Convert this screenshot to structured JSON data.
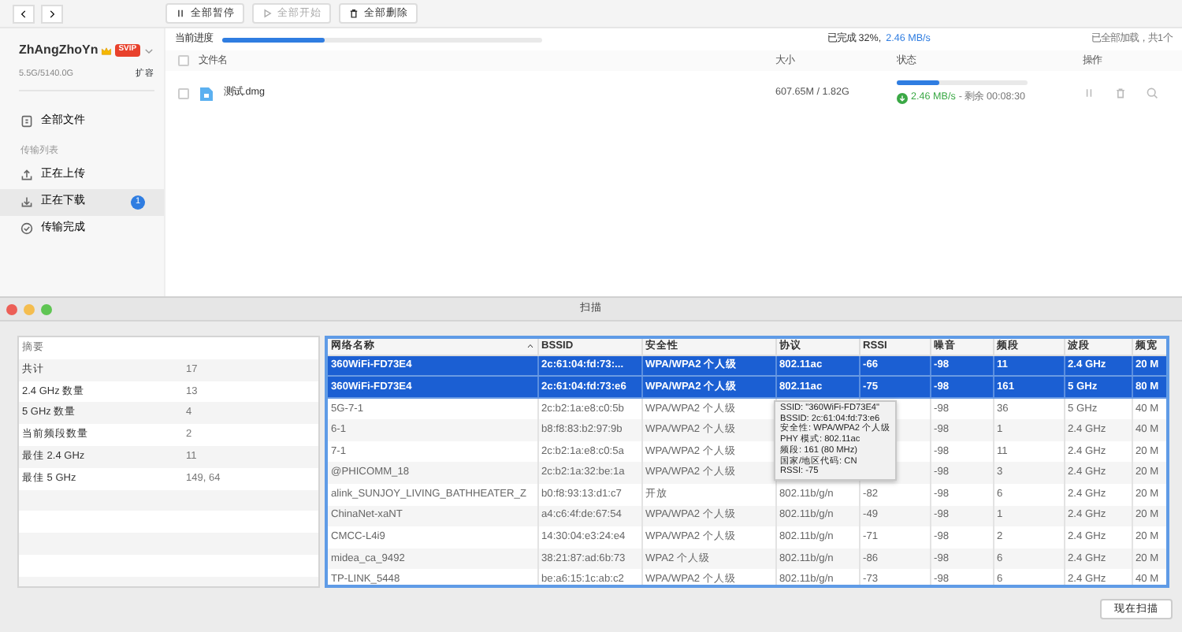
{
  "toolbar": [
    {
      "label": "全部暂停",
      "disabled": false
    },
    {
      "label": "全部开始",
      "disabled": true
    },
    {
      "label": "全部删除",
      "disabled": false
    }
  ],
  "account": {
    "username": "ZhAngZhoYn",
    "badge": "SVIP",
    "storage": "5.5G/5140.0G",
    "expand_link": "扩容"
  },
  "sidebar": {
    "items": [
      {
        "kind": "item",
        "label": "全部文件",
        "selected": false
      },
      {
        "kind": "heading",
        "label": "传输列表"
      },
      {
        "kind": "item",
        "label": "正在上传",
        "selected": false
      },
      {
        "kind": "item",
        "label": "正在下载",
        "selected": true,
        "badge": "1"
      },
      {
        "kind": "item",
        "label": "传输完成",
        "selected": false
      }
    ]
  },
  "progress": {
    "label": "当前进度",
    "level": 0.32,
    "text": "已完成 32%,",
    "speed": "2.46 MB/s",
    "summary": "已全部加载，共1个"
  },
  "file_table": {
    "select_all_checked": false,
    "columns": [
      "文件名",
      "大小",
      "状态",
      "操作"
    ],
    "rows": [
      {
        "name": "测试.dmg",
        "checked": false,
        "size": "607.65M / 1.82G",
        "level": 0.33,
        "speed": "2.46 MB/s",
        "remaining": "- 剩余 00:08:30"
      }
    ]
  },
  "scan_window": {
    "title": "扫描",
    "summary": {
      "heading": "摘要",
      "rows": [
        {
          "label": "共计",
          "value": "17"
        },
        {
          "label": "2.4 GHz 数量",
          "value": "13"
        },
        {
          "label": "5 GHz 数量",
          "value": "4"
        },
        {
          "label": "当前频段数量",
          "value": "2"
        },
        {
          "label": "最佳 2.4 GHz",
          "value": "11"
        },
        {
          "label": "最佳 5 GHz",
          "value": "149, 64"
        }
      ]
    },
    "networks": {
      "columns": [
        {
          "label": "网络名称",
          "sorted": true
        },
        {
          "label": "BSSID",
          "sorted": false
        },
        {
          "label": "安全性",
          "sorted": false
        },
        {
          "label": "协议",
          "sorted": false
        },
        {
          "label": "RSSI",
          "sorted": false
        },
        {
          "label": "噪音",
          "sorted": false
        },
        {
          "label": "频段",
          "sorted": false
        },
        {
          "label": "波段",
          "sorted": false
        },
        {
          "label": "频宽",
          "sorted": false
        }
      ],
      "rows": [
        {
          "selected": true,
          "cells": [
            "360WiFi-FD73E4",
            "2c:61:04:fd:73:...",
            "WPA/WPA2 个人级",
            "802.11ac",
            "-66",
            "-98",
            "11",
            "2.4 GHz",
            "20 M"
          ]
        },
        {
          "selected": true,
          "cells": [
            "360WiFi-FD73E4",
            "2c:61:04:fd:73:e6",
            "WPA/WPA2 个人级",
            "802.11ac",
            "-75",
            "-98",
            "161",
            "5 GHz",
            "80 M"
          ]
        },
        {
          "selected": false,
          "cells": [
            "5G-7-1",
            "2c:b2:1a:e8:c0:5b",
            "WPA/WPA2 个人级",
            null,
            null,
            "-98",
            "36",
            "5 GHz",
            "40 M"
          ]
        },
        {
          "selected": false,
          "cells": [
            "6-1",
            "b8:f8:83:b2:97:9b",
            "WPA/WPA2 个人级",
            null,
            null,
            "-98",
            "1",
            "2.4 GHz",
            "40 M"
          ]
        },
        {
          "selected": false,
          "cells": [
            "7-1",
            "2c:b2:1a:e8:c0:5a",
            "WPA/WPA2 个人级",
            null,
            null,
            "-98",
            "11",
            "2.4 GHz",
            "20 M"
          ]
        },
        {
          "selected": false,
          "cells": [
            "@PHICOMM_18",
            "2c:b2:1a:32:be:1a",
            "WPA/WPA2 个人级",
            null,
            null,
            "-98",
            "3",
            "2.4 GHz",
            "20 M"
          ]
        },
        {
          "selected": false,
          "cells": [
            "alink_SUNJOY_LIVING_BATHHEATER_Z",
            "b0:f8:93:13:d1:c7",
            "开放",
            "802.11b/g/n",
            "-82",
            "-98",
            "6",
            "2.4 GHz",
            "20 M"
          ]
        },
        {
          "selected": false,
          "cells": [
            "ChinaNet-xaNT",
            "a4:c6:4f:de:67:54",
            "WPA/WPA2 个人级",
            "802.11b/g/n",
            "-49",
            "-98",
            "1",
            "2.4 GHz",
            "20 M"
          ]
        },
        {
          "selected": false,
          "cells": [
            "CMCC-L4i9",
            "14:30:04:e3:24:e4",
            "WPA/WPA2 个人级",
            "802.11b/g/n",
            "-71",
            "-98",
            "2",
            "2.4 GHz",
            "20 M"
          ]
        },
        {
          "selected": false,
          "cells": [
            "midea_ca_9492",
            "38:21:87:ad:6b:73",
            "WPA2 个人级",
            "802.11b/g/n",
            "-86",
            "-98",
            "6",
            "2.4 GHz",
            "20 M"
          ]
        },
        {
          "selected": false,
          "cells": [
            "TP-LINK_5448",
            "be:a6:15:1c:ab:c2",
            "WPA/WPA2 个人级",
            "802.11b/g/n",
            "-73",
            "-98",
            "6",
            "2.4 GHz",
            "40 M"
          ]
        }
      ]
    },
    "tooltip": {
      "lines": [
        "SSID: \"360WiFi-FD73E4\"",
        "BSSID: 2c:61:04:fd:73:e6",
        "安全性: WPA/WPA2 个人级",
        "PHY 模式: 802.11ac",
        "频段: 161 (80 MHz)",
        "国家/地区代码: CN",
        "RSSI: -75"
      ]
    },
    "scan_button": "现在扫描"
  }
}
